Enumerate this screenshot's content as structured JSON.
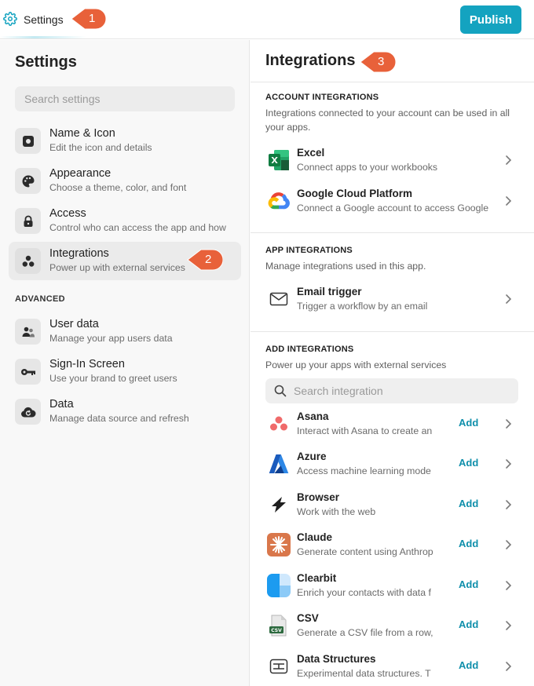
{
  "topbar": {
    "title": "Settings",
    "publish_label": "Publish"
  },
  "callouts": [
    "1",
    "2",
    "3"
  ],
  "sidebar": {
    "title": "Settings",
    "search_placeholder": "Search settings",
    "items": [
      {
        "label": "Name & Icon",
        "desc": "Edit the icon and details",
        "icon": "app-icon"
      },
      {
        "label": "Appearance",
        "desc": "Choose a theme, color, and font",
        "icon": "palette-icon"
      },
      {
        "label": "Access",
        "desc": "Control who can access the app and how",
        "icon": "lock-icon"
      },
      {
        "label": "Integrations",
        "desc": "Power up with external services",
        "icon": "integrations-icon",
        "active": true
      }
    ],
    "advanced_label": "ADVANCED",
    "advanced_items": [
      {
        "label": "User data",
        "desc": "Manage your app users data",
        "icon": "users-icon"
      },
      {
        "label": "Sign-In Screen",
        "desc": "Use your brand to greet users",
        "icon": "key-icon"
      },
      {
        "label": "Data",
        "desc": "Manage data source and refresh",
        "icon": "cloud-refresh-icon"
      }
    ]
  },
  "main": {
    "title": "Integrations",
    "account": {
      "heading": "ACCOUNT INTEGRATIONS",
      "desc": "Integrations connected to your account can be used in all your apps.",
      "items": [
        {
          "label": "Excel",
          "desc": "Connect apps to your workbooks",
          "icon": "excel-icon"
        },
        {
          "label": "Google Cloud Platform",
          "desc": "Connect a Google account to access Google",
          "icon": "google-cloud-icon"
        }
      ]
    },
    "app": {
      "heading": "APP INTEGRATIONS",
      "desc": "Manage integrations used in this app.",
      "items": [
        {
          "label": "Email trigger",
          "desc": "Trigger a workflow by an email",
          "icon": "mail-icon"
        }
      ]
    },
    "add": {
      "heading": "ADD INTEGRATIONS",
      "desc": "Power up your apps with external services",
      "search_placeholder": "Search integration",
      "add_label": "Add",
      "items": [
        {
          "label": "Asana",
          "desc": "Interact with Asana to create an",
          "icon": "asana-icon"
        },
        {
          "label": "Azure",
          "desc": "Access machine learning mode",
          "icon": "azure-icon"
        },
        {
          "label": "Browser",
          "desc": "Work with the web",
          "icon": "browser-icon"
        },
        {
          "label": "Claude",
          "desc": "Generate content using Anthrop",
          "icon": "claude-icon"
        },
        {
          "label": "Clearbit",
          "desc": "Enrich your contacts with data f",
          "icon": "clearbit-icon"
        },
        {
          "label": "CSV",
          "desc": "Generate a CSV file from a row,",
          "icon": "csv-icon"
        },
        {
          "label": "Data Structures",
          "desc": "Experimental data structures. T",
          "icon": "data-structures-icon"
        }
      ]
    }
  },
  "colors": {
    "accent": "#14a3c0",
    "callout": "#e8613a",
    "add_link": "#0f8fab"
  }
}
